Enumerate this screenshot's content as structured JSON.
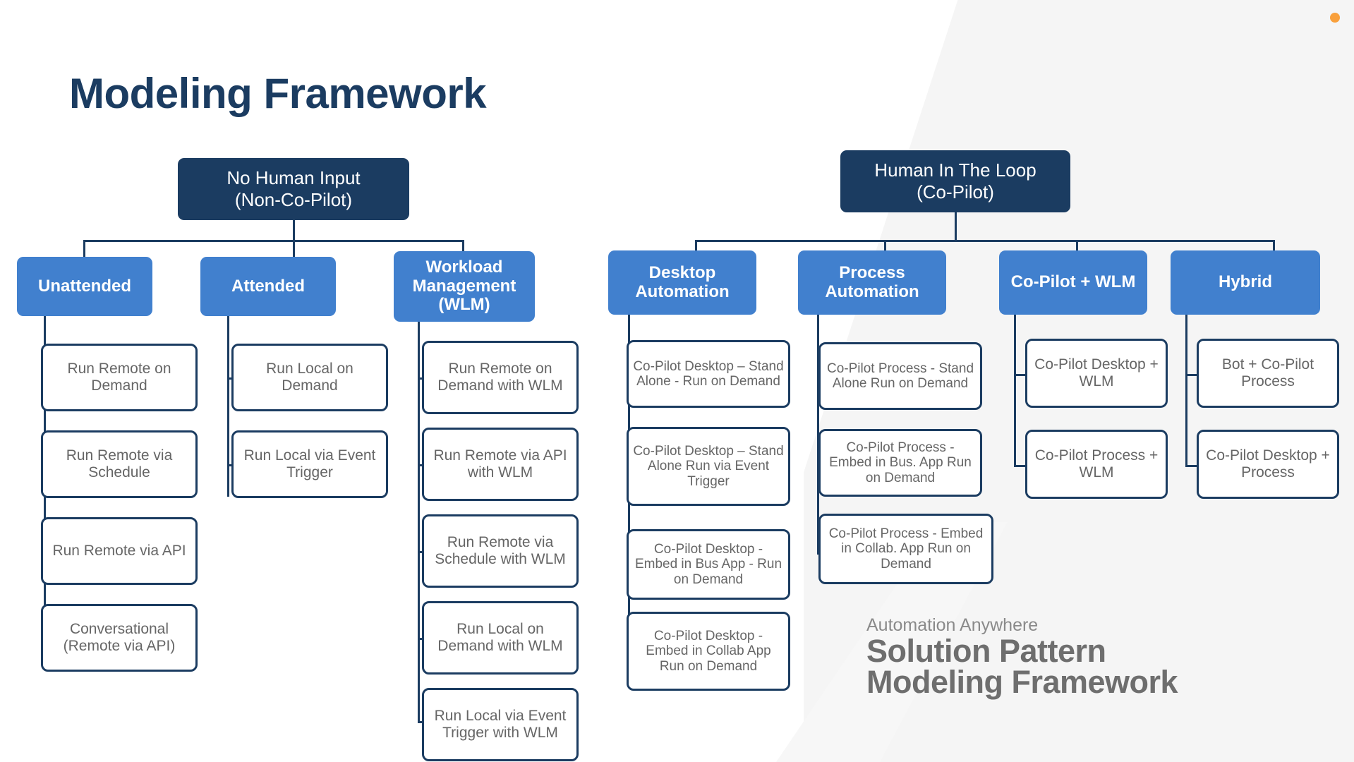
{
  "page": {
    "title": "Modeling Framework",
    "accent_navy": "#1b3c61",
    "accent_blue": "#4180ce",
    "leaf_text": "#666666",
    "dot_color": "#f9a03c"
  },
  "branding": {
    "company": "Automation Anywhere",
    "line1": "Solution Pattern",
    "line2": "Modeling Framework"
  },
  "trees": {
    "left": {
      "root": "No Human Input\n(Non-Co-Pilot)",
      "root_line1": "No Human Input",
      "root_line2": "(Non-Co-Pilot)",
      "categories": [
        {
          "label": "Unattended",
          "leaves": [
            "Run Remote on Demand",
            "Run Remote via Schedule",
            "Run Remote via API",
            "Conversational (Remote via API)"
          ]
        },
        {
          "label": "Attended",
          "leaves": [
            "Run Local on Demand",
            "Run Local via Event Trigger"
          ]
        },
        {
          "label": "Workload Management (WLM)",
          "leaves": [
            "Run Remote on Demand with WLM",
            "Run Remote via API with WLM",
            "Run Remote via Schedule with WLM",
            "Run Local on Demand with WLM",
            "Run Local via Event Trigger with WLM"
          ]
        }
      ]
    },
    "right": {
      "root": "Human In The Loop\n(Co-Pilot)",
      "root_line1": "Human In The Loop",
      "root_line2": "(Co-Pilot)",
      "categories": [
        {
          "label": "Desktop Automation",
          "leaves": [
            "Co-Pilot Desktop – Stand Alone - Run on Demand",
            "Co-Pilot Desktop – Stand Alone Run via Event Trigger",
            "Co-Pilot Desktop - Embed in Bus App - Run on Demand",
            "Co-Pilot Desktop - Embed in Collab App  Run on Demand"
          ]
        },
        {
          "label": "Process Automation",
          "leaves": [
            "Co-Pilot Process - Stand Alone Run on Demand",
            "Co-Pilot Process - Embed in Bus. App Run on Demand",
            "Co-Pilot Process - Embed in Collab. App Run on Demand"
          ]
        },
        {
          "label": "Co-Pilot + WLM",
          "leaves": [
            "Co-Pilot Desktop + WLM",
            "Co-Pilot Process + WLM"
          ]
        },
        {
          "label": "Hybrid",
          "leaves": [
            "Bot + Co-Pilot Process",
            "Co-Pilot Desktop + Process"
          ]
        }
      ]
    }
  }
}
